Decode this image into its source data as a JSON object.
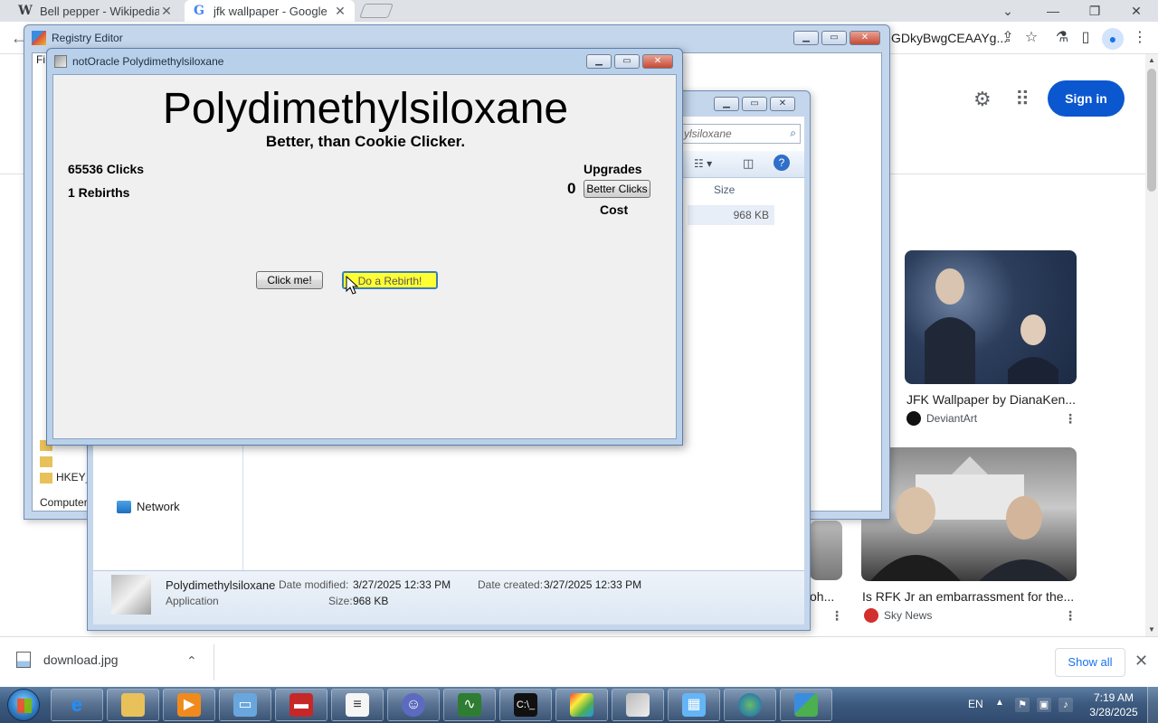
{
  "chrome": {
    "tabs": [
      {
        "label": "Bell pepper - Wikipedia",
        "favicon": "W",
        "close": "✕"
      },
      {
        "label": "jfk wallpaper - Google",
        "favicon": "G",
        "close": "✕"
      }
    ],
    "omnibox_tail": "GDkyBwgCEAAYg...",
    "sign_in": "Sign in",
    "results": [
      {
        "title": "JFK Wallpaper by DianaKen...",
        "source": "DeviantArt"
      },
      {
        "title": "Is RFK Jr an embarrassment for the...",
        "source": "Sky News"
      },
      {
        "title": "oh..."
      }
    ]
  },
  "download_bar": {
    "file": "download.jpg",
    "show_all": "Show all"
  },
  "registry": {
    "title": "Registry Editor",
    "menu_first": "Fi",
    "hkey": "HKEY_C",
    "status": "Computer\\"
  },
  "explorer": {
    "search": "ylsiloxane",
    "col_size": "Size",
    "row_size": "968 KB",
    "network": "Network",
    "details": {
      "name": "Polydimethylsiloxane",
      "type": "Application",
      "modified_label": "Date modified:",
      "modified": "3/27/2025 12:33 PM",
      "created_label": "Date created:",
      "created": "3/27/2025 12:33 PM",
      "size_label": "Size:",
      "size": "968 KB"
    }
  },
  "app": {
    "window_title": "notOracle Polydimethylsiloxane",
    "heading": "Polydimethylsiloxane",
    "subtitle": "Better, than Cookie Clicker.",
    "clicks": "65536 Clicks",
    "rebirths": "1 Rebirths",
    "upgrades_label": "Upgrades",
    "upgrade_count": "0",
    "better_clicks": "Better Clicks",
    "cost_label": "Cost",
    "click_me": "Click me!",
    "rebirth": "Do a Rebirth!"
  },
  "taskbar": {
    "lang": "EN",
    "time": "7:19 AM",
    "date": "3/28/2025",
    "apps": [
      "internet-explorer",
      "file-explorer",
      "media-player",
      "remote-desktop",
      "toolbox",
      "notepad",
      "user-account",
      "task-manager",
      "command-prompt",
      "paint",
      "thumbnail-viewer",
      "control-panel",
      "network-globe",
      "registry-editor"
    ]
  }
}
